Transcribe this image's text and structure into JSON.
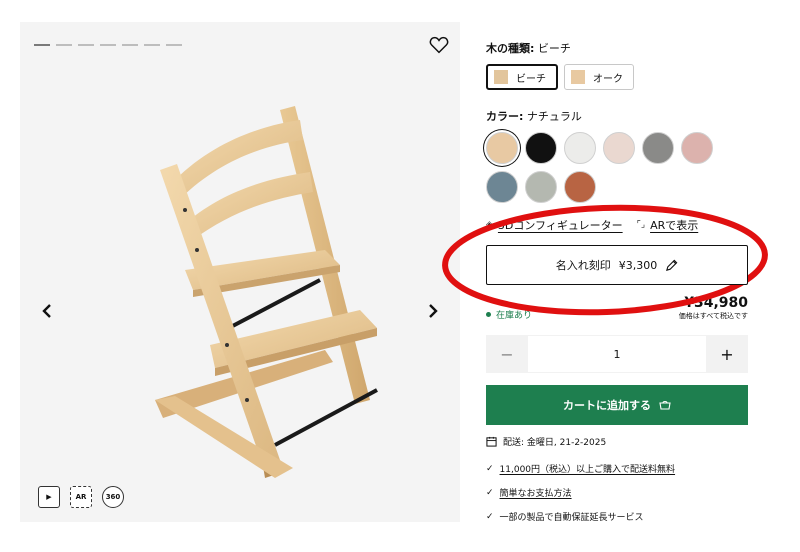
{
  "gallery": {
    "dots_count": 7,
    "active_dot": 0,
    "tools": {
      "video_label": "▶",
      "ar_label": "AR",
      "spin_label": "360"
    }
  },
  "wood": {
    "label": "木の種類:",
    "selected_value": "ビーチ",
    "options": [
      {
        "label": "ビーチ",
        "color": "#e2c59c",
        "selected": true
      },
      {
        "label": "オーク",
        "color": "#e8c9a1",
        "selected": false
      }
    ]
  },
  "color": {
    "label": "カラー:",
    "selected_value": "ナチュラル",
    "swatches": [
      {
        "name": "natural",
        "hex": "#e8c9a3",
        "selected": true
      },
      {
        "name": "black",
        "hex": "#111111",
        "selected": false
      },
      {
        "name": "white",
        "hex": "#ececea",
        "selected": false
      },
      {
        "name": "light-pink",
        "hex": "#ead8d0",
        "selected": false
      },
      {
        "name": "grey",
        "hex": "#8a8a88",
        "selected": false
      },
      {
        "name": "pink",
        "hex": "#dcb2ad",
        "selected": false
      },
      {
        "name": "blue-grey",
        "hex": "#6d8694",
        "selected": false
      },
      {
        "name": "sage",
        "hex": "#b4b8b0",
        "selected": false
      },
      {
        "name": "terracotta",
        "hex": "#b86443",
        "selected": false
      }
    ]
  },
  "links": {
    "configurator": "3Dコンフィギュレーター",
    "ar": "ARで表示"
  },
  "engrave": {
    "label": "名入れ刻印",
    "price": "¥3,300"
  },
  "stock": {
    "label": "在庫あり"
  },
  "price": {
    "value": "¥34,980",
    "tax_note": "価格はすべて税込です"
  },
  "quantity": {
    "minus": "−",
    "value": "1",
    "plus": "+"
  },
  "cart": {
    "label": "カートに追加する"
  },
  "delivery": {
    "label": "配送: 金曜日, 21-2-2025"
  },
  "benefits": [
    {
      "mark": "✓",
      "text": "11,000円（税込）以上ご購入で配送料無料",
      "underline": true
    },
    {
      "mark": "✓",
      "text": "簡単なお支払方法",
      "underline": true
    },
    {
      "mark": "✓",
      "text": "一部の製品で自動保証延長サービス",
      "underline": false
    }
  ],
  "colors": {
    "accent_green": "#1e7f4f",
    "annotation_red": "#e01010"
  }
}
